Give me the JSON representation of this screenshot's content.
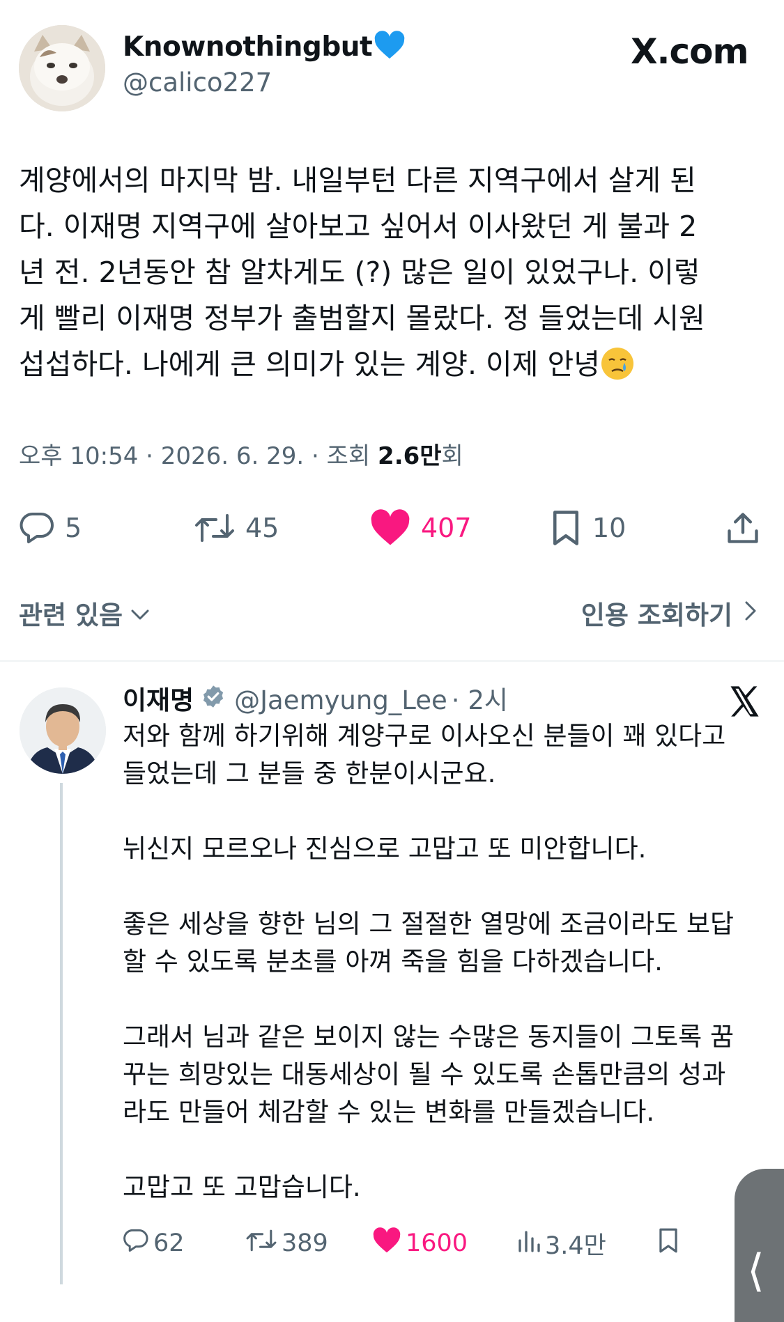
{
  "author": {
    "display_name": "Knownothingbut",
    "handle": "@calico227"
  },
  "brand": {
    "logo_text": "X.com"
  },
  "tweet": {
    "lines": [
      "계양에서의 마지막 밤. 내일부턴 다른 지역구에서 살게 된",
      "다. 이재명 지역구에 살아보고 싶어서 이사왔던 게 불과 2",
      "년 전. 2년동안 참 알차게도 (?) 많은 일이 있었구나. 이렇",
      "게 빨리 이재명 정부가 출범할지 몰랐다. 정 들었는데 시원",
      "섭섭하다. 나에게 큰 의미가 있는 계양. 이제 안녕"
    ],
    "emoji": "crying-face-emoji"
  },
  "meta": {
    "time": "오후 10:54 · 2026. 6. 29. · 조회 ",
    "views": "2.6만",
    "views_suffix": "회"
  },
  "actions": {
    "replies": "5",
    "retweets": "45",
    "likes": "407",
    "bookmarks": "10"
  },
  "related": {
    "label": "관련 있음"
  },
  "quote": {
    "label": "인용 조회하기"
  },
  "reply": {
    "display_name": "이재명",
    "handle": "@Jaemyung_Lee",
    "time": "· 2시",
    "paragraphs": [
      [
        "저와 함께 하기위해 계양구로 이사오신 분들이 꽤 있다고",
        "들었는데 그 분들 중 한분이시군요."
      ],
      [
        "뉘신지 모르오나 진심으로 고맙고 또 미안합니다."
      ],
      [
        "좋은 세상을 향한 님의 그 절절한 열망에 조금이라도 보답",
        "할 수 있도록 분초를 아껴 죽을 힘을 다하겠습니다."
      ],
      [
        "그래서 님과 같은 보이지 않는 수많은 동지들이 그토록 꿈",
        "꾸는 희망있는 대동세상이 될 수 있도록 손톱만큼의 성과",
        "라도 만들어 체감할 수 있는 변화를 만들겠습니다."
      ],
      [
        "고맙고 또 고맙습니다."
      ]
    ],
    "actions": {
      "replies": "62",
      "retweets": "389",
      "likes": "1600",
      "views": "3.4만"
    }
  },
  "colors": {
    "like_pink": "#f91880",
    "verified_gray": "#829aab",
    "heart_blue": "#1d9bf0",
    "muted": "#536471"
  }
}
